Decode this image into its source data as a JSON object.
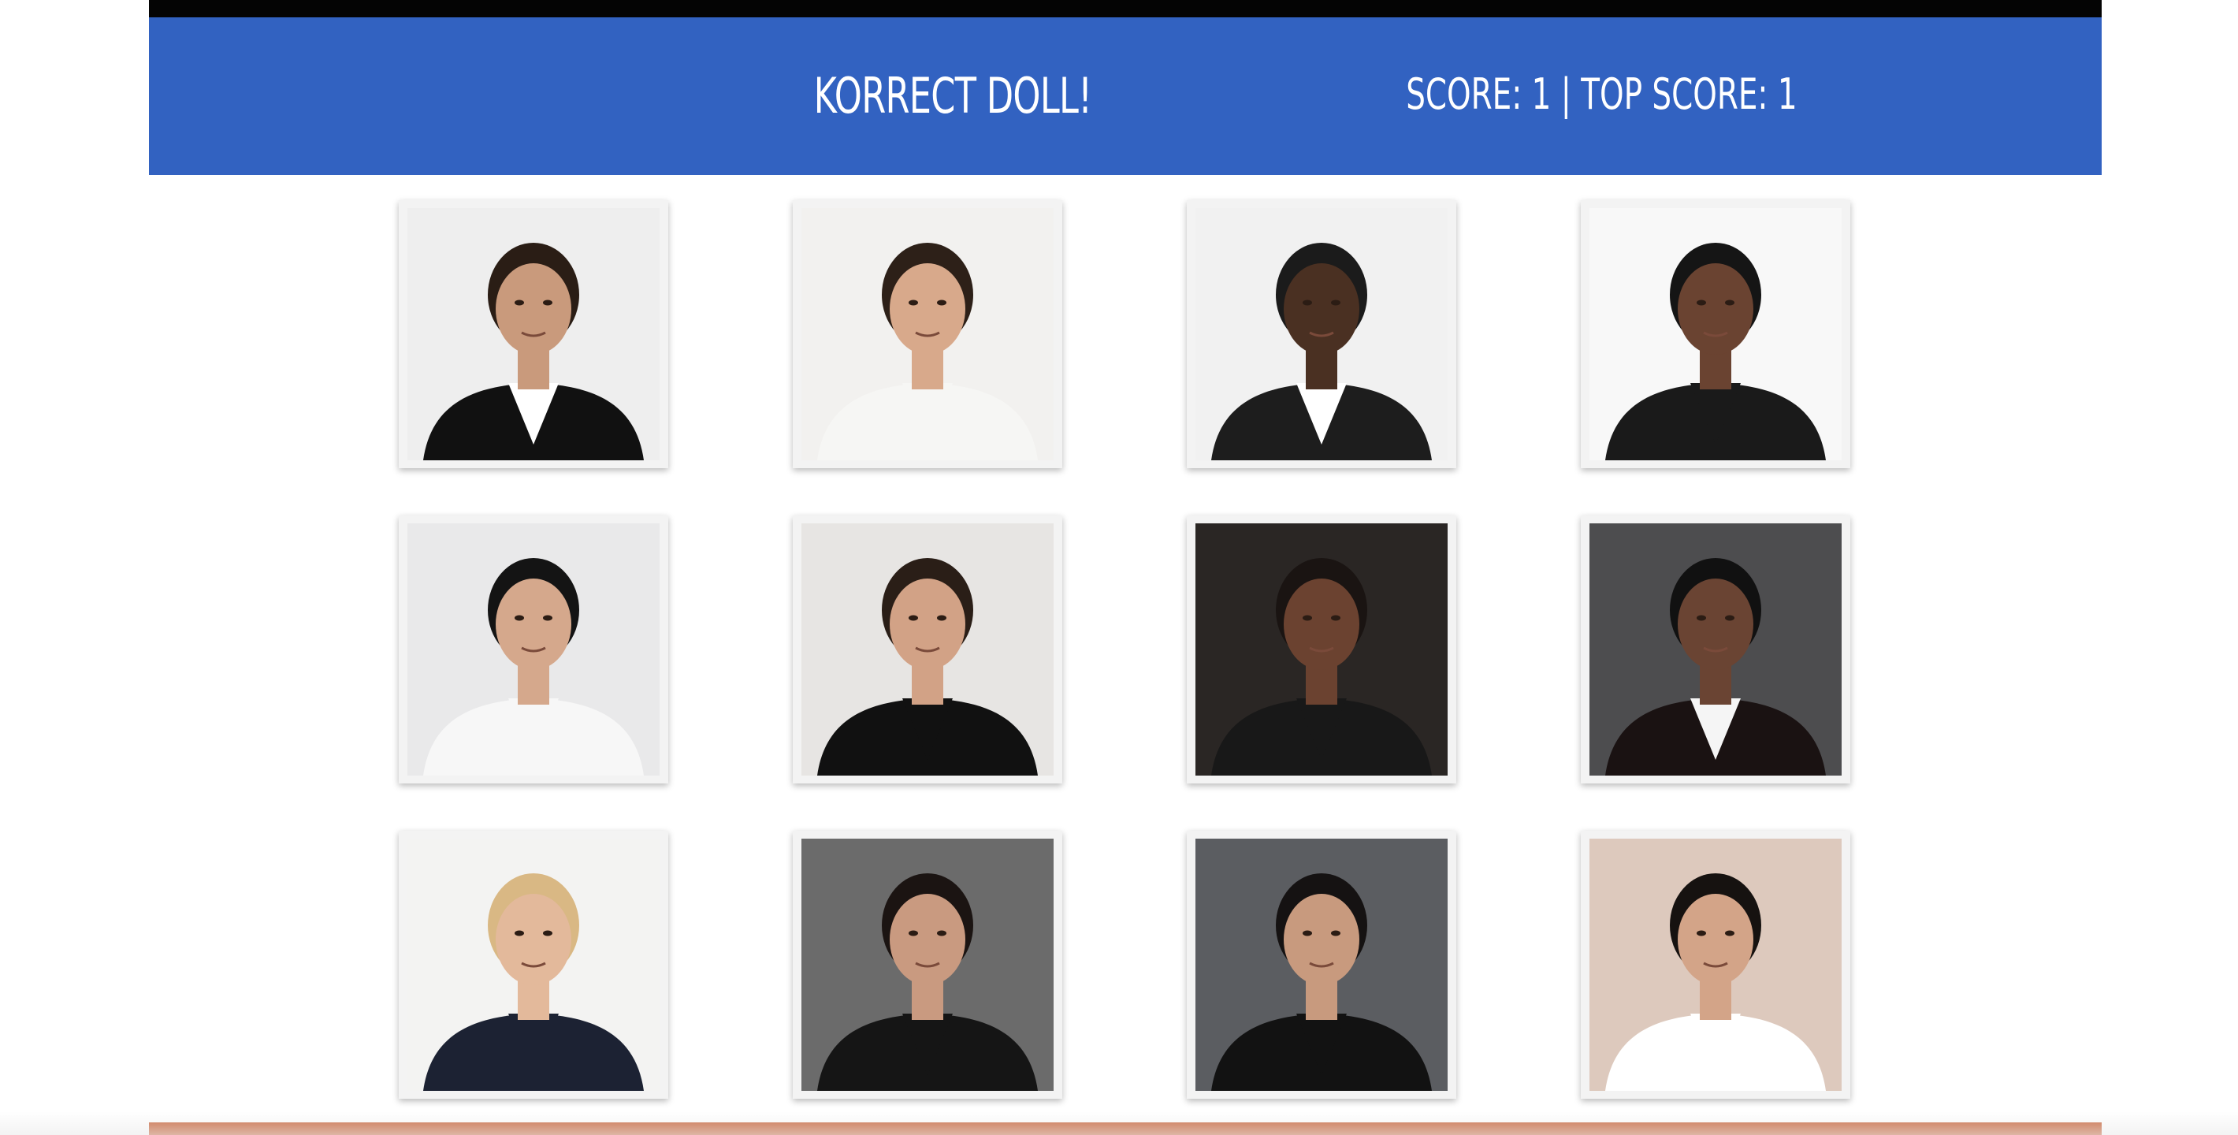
{
  "header": {
    "title": "KORRECT DOLL!",
    "score_label": "SCORE:",
    "score": 1,
    "separator": "|",
    "top_score_label": "TOP SCORE:",
    "top_score": 1
  },
  "colors": {
    "header_bg": "#3262c1",
    "top_bar": "#040404",
    "footer_bar": "#c8663c",
    "card_bg": "#f3f3f3"
  },
  "cards": [
    {
      "bg": "#eeeeee",
      "skin": "#c99a7c",
      "hair": "#2a1d15",
      "outfit": "#111111",
      "shirt": "#ffffff"
    },
    {
      "bg": "#f2f1ef",
      "skin": "#d8a98b",
      "hair": "#2d2018",
      "outfit": "#f6f6f4",
      "shirt": "#f6f6f4"
    },
    {
      "bg": "#f1f1f1",
      "skin": "#4a3022",
      "hair": "#1b1b1b",
      "outfit": "#1d1d1d",
      "shirt": "#ffffff"
    },
    {
      "bg": "#f8f8f8",
      "skin": "#6a4331",
      "hair": "#151515",
      "outfit": "#1a1a1a",
      "shirt": "#1a1a1a"
    },
    {
      "bg": "#e9e9ea",
      "skin": "#d5a88c",
      "hair": "#141414",
      "outfit": "#f7f7f7",
      "shirt": "#f7f7f7"
    },
    {
      "bg": "#e7e5e3",
      "skin": "#d2a286",
      "hair": "#2a1e17",
      "outfit": "#111111",
      "shirt": "#111111"
    },
    {
      "bg": "#2a2624",
      "skin": "#6b4230",
      "hair": "#1a1412",
      "outfit": "#181818",
      "shirt": "#181818"
    },
    {
      "bg": "#4d4d4f",
      "skin": "#6a4433",
      "hair": "#111111",
      "outfit": "#1a1212",
      "shirt": "#f5f5f5"
    },
    {
      "bg": "#f3f3f2",
      "skin": "#e3b99b",
      "hair": "#d9b884",
      "outfit": "#1c2233",
      "shirt": "#1c2233"
    },
    {
      "bg": "#6b6b6b",
      "skin": "#c99a80",
      "hair": "#1b1412",
      "outfit": "#151515",
      "shirt": "#151515"
    },
    {
      "bg": "#5b5d61",
      "skin": "#c89a7e",
      "hair": "#151212",
      "outfit": "#121212",
      "shirt": "#121212"
    },
    {
      "bg": "#ddc9bd",
      "skin": "#d3a488",
      "hair": "#161210",
      "outfit": "#ffffff",
      "shirt": "#ffffff"
    }
  ]
}
